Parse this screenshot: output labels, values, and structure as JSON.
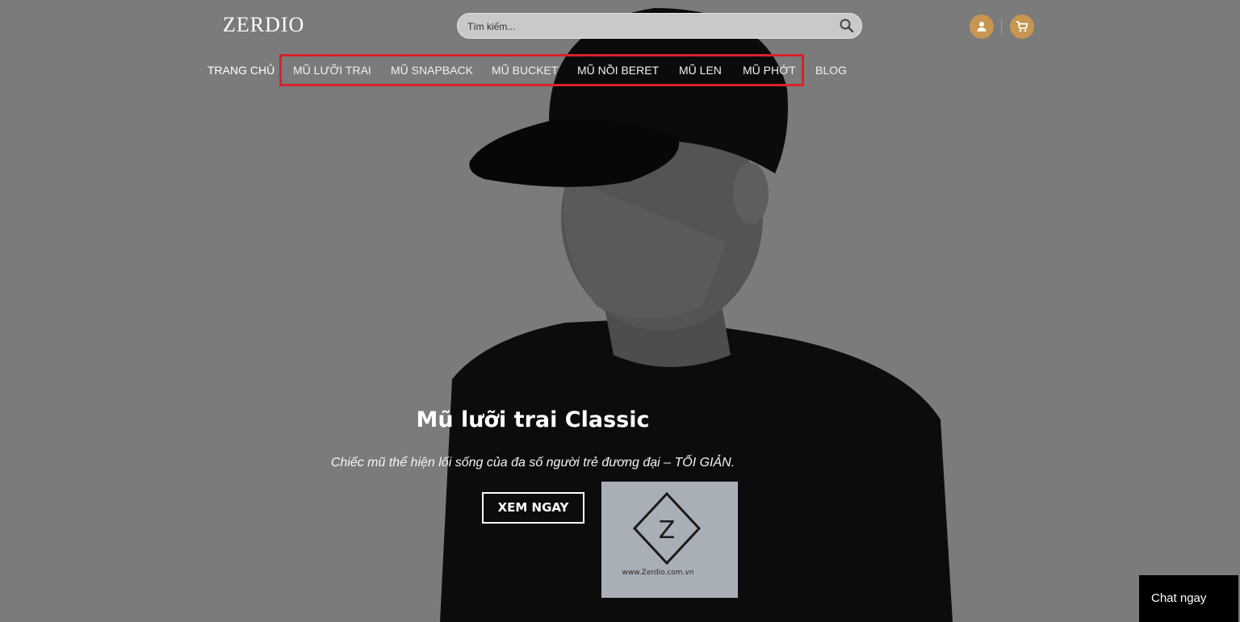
{
  "header": {
    "logo": "ZERDIO",
    "search": {
      "placeholder": "Tìm kiếm..."
    },
    "icons": {
      "search": "search-icon",
      "account": "user-icon",
      "cart": "cart-icon"
    }
  },
  "nav": {
    "items": [
      {
        "label": "TRANG CHỦ"
      },
      {
        "label": "MŨ LƯỠI TRAI"
      },
      {
        "label": "MŨ SNAPBACK"
      },
      {
        "label": "MŨ BUCKET"
      },
      {
        "label": "MŨ NỒI BERET"
      },
      {
        "label": "MŨ LEN"
      },
      {
        "label": "MŨ PHỚT"
      },
      {
        "label": "BLOG"
      }
    ]
  },
  "hero": {
    "title": "Mũ lưỡi trai Classic",
    "subtitle": "Chiếc mũ thể hiện lối sống của đa số người trẻ đương đại – TỐI GIẢN.",
    "cta": "XEM NGAY",
    "shirt_text": "www.Zerdio.com.vn",
    "shirt_logo": "Z"
  },
  "chat": {
    "label": "Chat ngay"
  },
  "colors": {
    "accent": "#c79650",
    "highlight": "#d8222c",
    "overlay": "#7b7b7b"
  }
}
